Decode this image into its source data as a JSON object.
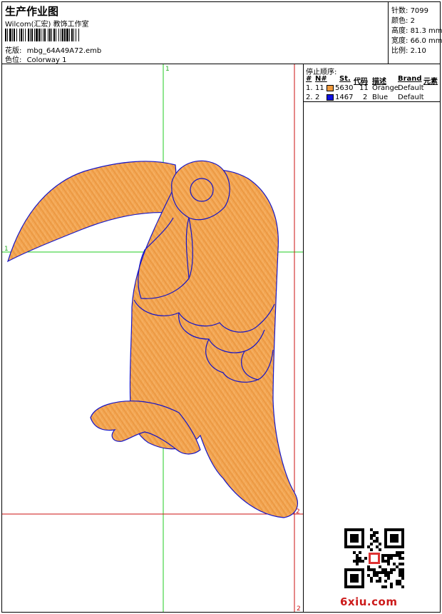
{
  "header": {
    "title": "生产作业图",
    "company": "Wilcom(汇宏) 教饰工作室",
    "design_label": "花版:",
    "design_value": "mbg_64A49A72.emb",
    "colorway_label": "色位:",
    "colorway_value": "Colorway 1"
  },
  "stats": [
    {
      "label": "针数:",
      "value": "7099"
    },
    {
      "label": "颜色:",
      "value": "2"
    },
    {
      "label": "高度:",
      "value": "81.3 mm"
    },
    {
      "label": "宽度:",
      "value": "66.0 mm"
    },
    {
      "label": "比例:",
      "value": "2.10"
    }
  ],
  "stop_sequence": {
    "title": "停止顺序:",
    "columns": [
      "#",
      "N#",
      "St.",
      "代码",
      "描述",
      "Brand",
      "元素"
    ],
    "rows": [
      {
        "num": "1.",
        "n": "11",
        "color": "#f09a3c",
        "stitches": "5630",
        "code": "11",
        "desc": "Orange",
        "brand": "Default"
      },
      {
        "num": "2.",
        "n": "2",
        "color": "#1010e0",
        "stitches": "1467",
        "code": "2",
        "desc": "Blue",
        "brand": "Default"
      }
    ]
  },
  "canvas": {
    "guide_labels": {
      "green_v": "1",
      "green_h": "1",
      "red_h": "2",
      "red_v": "2"
    },
    "colors": {
      "fill": "#f0a04a",
      "outline": "#1414c8",
      "green_guide": "#22cc22",
      "red_guide": "#cc1010"
    }
  },
  "watermark": "6xiu.com"
}
